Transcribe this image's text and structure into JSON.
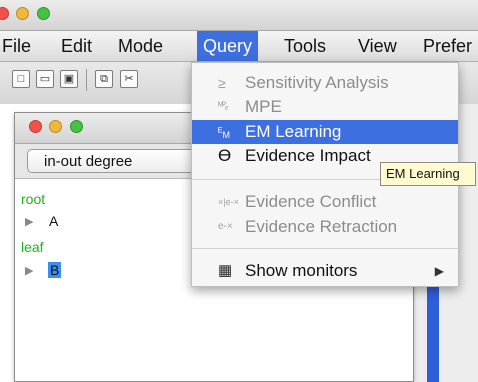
{
  "menu": [
    "File",
    "Edit",
    "Mode",
    "Query",
    "Tools",
    "View",
    "Prefer"
  ],
  "inner_window": {
    "selector_value": "in-out degree",
    "tree": [
      {
        "label": "root",
        "node": "A"
      },
      {
        "label": "leaf",
        "node": "B"
      }
    ]
  },
  "query_menu": {
    "items": [
      {
        "icon": "≥",
        "label": "Sensitivity Analysis",
        "enabled": false
      },
      {
        "icon": "MPE-sub",
        "label": "MPE",
        "enabled": false
      },
      {
        "icon": "EM-sub",
        "label": "EM Learning",
        "enabled": true,
        "highlighted": true
      },
      {
        "icon": "ϴ",
        "label": "Evidence Impact",
        "enabled": true
      },
      {
        "icon": "×|e-×",
        "label": "Evidence Conflict",
        "enabled": false
      },
      {
        "icon": "e-×",
        "label": "Evidence Retraction",
        "enabled": false
      },
      {
        "icon": "monitor",
        "label": "Show monitors",
        "enabled": true,
        "submenu": true
      }
    ]
  },
  "tooltip": "EM Learning",
  "colors": {
    "highlight": "#3d6fe0",
    "tree_label": "#22b022"
  }
}
